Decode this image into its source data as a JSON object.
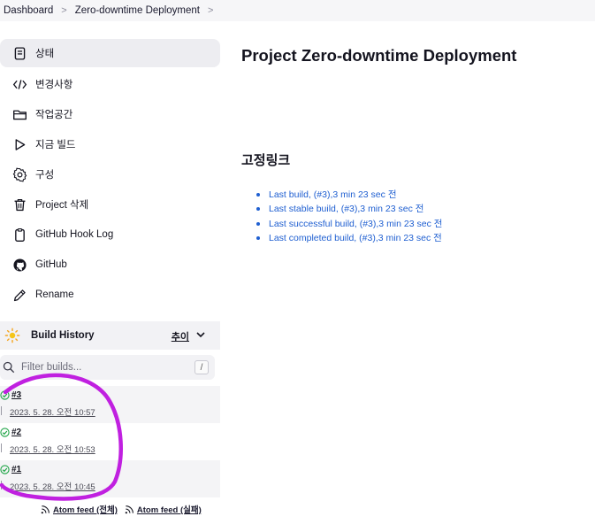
{
  "breadcrumb": {
    "items": [
      "Dashboard",
      "Zero-downtime Deployment"
    ],
    "separator": ">"
  },
  "sidebar": {
    "items": [
      {
        "label": "상태",
        "icon": "document-icon"
      },
      {
        "label": "변경사항",
        "icon": "code-icon"
      },
      {
        "label": "작업공간",
        "icon": "folder-icon"
      },
      {
        "label": "지금 빌드",
        "icon": "play-icon"
      },
      {
        "label": "구성",
        "icon": "gear-icon"
      },
      {
        "label": "Project 삭제",
        "icon": "trash-icon"
      },
      {
        "label": "GitHub Hook Log",
        "icon": "clipboard-icon"
      },
      {
        "label": "GitHub",
        "icon": "github-icon"
      },
      {
        "label": "Rename",
        "icon": "pencil-icon"
      }
    ]
  },
  "build_history": {
    "title": "Build History",
    "trend_label": "추이",
    "filter_placeholder": "Filter builds...",
    "filter_shortcut": "/",
    "builds": [
      {
        "number": "#3",
        "time": "2023. 5. 28. 오전 10:57"
      },
      {
        "number": "#2",
        "time": "2023. 5. 28. 오전 10:53"
      },
      {
        "number": "#1",
        "time": "2023. 5. 28. 오전 10:45"
      }
    ],
    "feeds": {
      "all": "Atom feed (전체)",
      "failures": "Atom feed (실패)"
    }
  },
  "main": {
    "title": "Project Zero-downtime Deployment",
    "permalinks_heading": "고정링크",
    "permalinks": [
      "Last build, (#3),3 min 23 sec 전",
      "Last stable build, (#3),3 min 23 sec 전",
      "Last successful build, (#3),3 min 23 sec 전",
      "Last completed build, (#3),3 min 23 sec 전"
    ]
  },
  "colors": {
    "link": "#1f5fd1",
    "annotation": "#c020e0",
    "success": "#1ea446"
  }
}
